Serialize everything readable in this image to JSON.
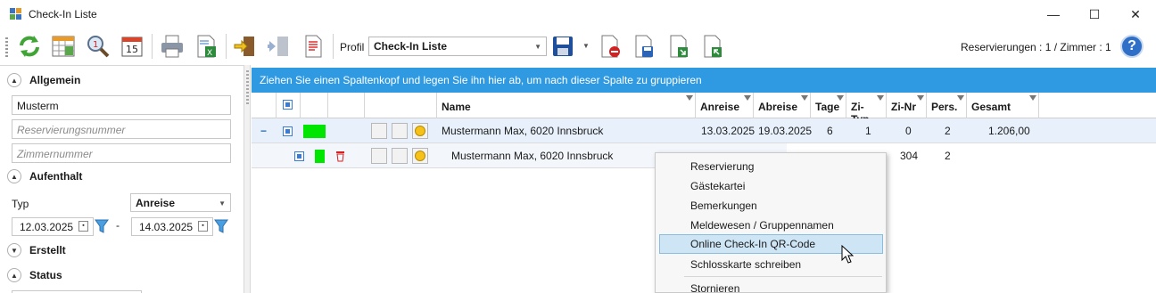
{
  "window": {
    "title": "Check-In Liste",
    "min": "—",
    "max": "☐",
    "close": "✕"
  },
  "toolbar": {
    "profil_label": "Profil",
    "profil_value": "Check-In Liste",
    "counts": "Reservierungen : 1  /  Zimmer : 1",
    "help": "?"
  },
  "left": {
    "allgemein": "Allgemein",
    "name_value": "Musterm",
    "resnr_placeholder": "Reservierungsnummer",
    "zimmernr_placeholder": "Zimmernummer",
    "aufenthalt": "Aufenthalt",
    "typ_label": "Typ",
    "typ_value": "Anreise",
    "date_from": "12.03.2025",
    "date_sep": "-",
    "date_to": "14.03.2025",
    "erstellt": "Erstellt",
    "status": "Status"
  },
  "grid": {
    "groupbar": "Ziehen Sie einen Spaltenkopf und legen Sie ihn hier ab, um nach dieser Spalte zu gruppieren",
    "columns": {
      "name": "Name",
      "anreise": "Anreise",
      "abreise": "Abreise",
      "tage": "Tage",
      "zityp": "Zi-Typ",
      "zinr": "Zi-Nr",
      "pers": "Pers.",
      "gesamt": "Gesamt"
    },
    "row1": {
      "expander": "−",
      "name": "Mustermann Max, 6020 Innsbruck",
      "anreise": "13.03.2025",
      "abreise": "19.03.2025",
      "tage": "6",
      "zityp": "1",
      "zinr": "0",
      "pers": "2",
      "gesamt": "1.206,00"
    },
    "row2": {
      "name": "Mustermann Max, 6020 Innsbruck",
      "zinr": "304",
      "pers": "2"
    }
  },
  "context_menu": {
    "items": [
      "Reservierung",
      "Gästekartei",
      "Bemerkungen",
      "Meldewesen / Gruppennamen",
      "Online Check-In QR-Code",
      "Schlosskarte schreiben"
    ],
    "after_sep": "Stornieren"
  },
  "colors": {
    "accent": "#2f9ae2",
    "status_green": "#00e600",
    "delete_red": "#d42020"
  }
}
